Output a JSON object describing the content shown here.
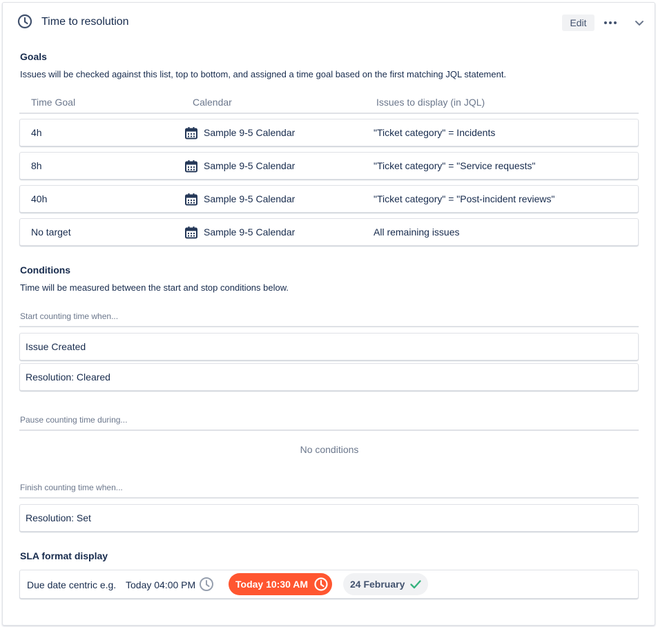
{
  "header": {
    "title": "Time to resolution",
    "edit_label": "Edit",
    "icons": {
      "title": "clock-icon",
      "more": "more-icon",
      "collapse": "chevron-down-icon"
    }
  },
  "goals": {
    "title": "Goals",
    "description": "Issues will be checked against this list, top to bottom, and assigned a time goal based on the first matching JQL statement.",
    "columns": [
      "Time Goal",
      "Calendar",
      "Issues to display (in JQL)"
    ],
    "rows": [
      {
        "goal": "4h",
        "calendar": "Sample 9-5 Calendar",
        "jql": "\"Ticket category\" = Incidents"
      },
      {
        "goal": "8h",
        "calendar": "Sample 9-5 Calendar",
        "jql": "\"Ticket category\" = \"Service requests\""
      },
      {
        "goal": "40h",
        "calendar": "Sample 9-5 Calendar",
        "jql": "\"Ticket category\" = \"Post-incident reviews\""
      },
      {
        "goal": "No target",
        "calendar": "Sample 9-5 Calendar",
        "jql": "All remaining issues"
      }
    ]
  },
  "conditions": {
    "title": "Conditions",
    "description": "Time will be measured between the start and stop conditions below.",
    "start": {
      "label": "Start counting time when...",
      "items": [
        "Issue Created",
        "Resolution: Cleared"
      ]
    },
    "pause": {
      "label": "Pause counting time during...",
      "empty_text": "No conditions"
    },
    "finish": {
      "label": "Finish counting time when...",
      "items": [
        "Resolution: Set"
      ]
    }
  },
  "sla_format": {
    "title": "SLA format display",
    "label": "Due date centric e.g.",
    "due_text": "Today 04:00 PM",
    "breached_text": "Today 10:30 AM",
    "met_text": "24 February",
    "colors": {
      "breached": "#ff5630",
      "met": "#36b37e",
      "neutral": "#f1f2f4"
    }
  }
}
